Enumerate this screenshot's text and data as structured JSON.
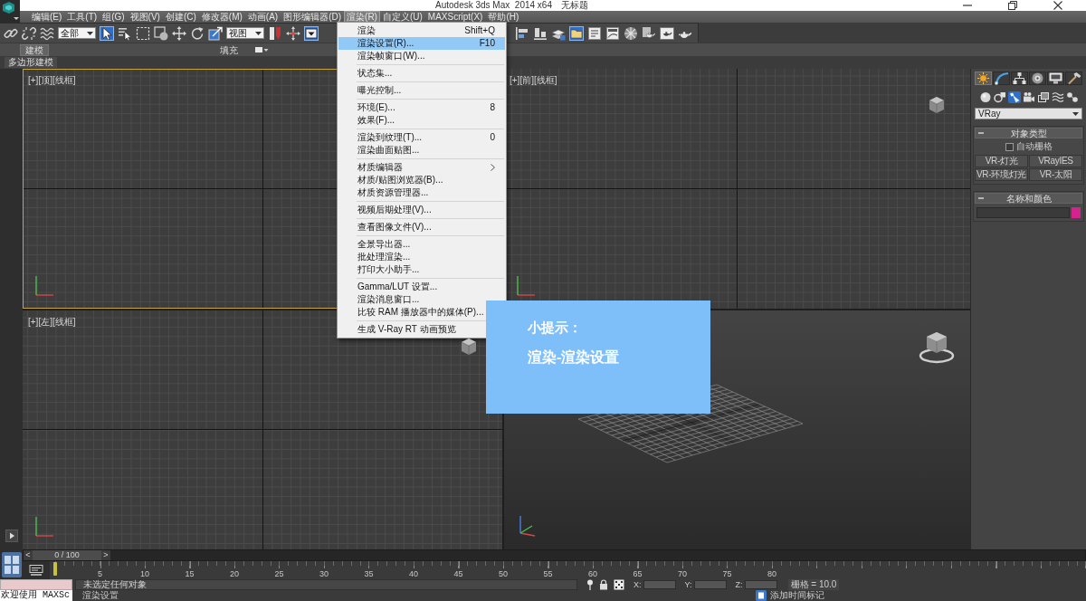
{
  "window": {
    "title": "Autodesk 3ds Max  2014 x64",
    "document": "无标题"
  },
  "menu_bar": [
    {
      "label": "编辑(E)",
      "selected": false
    },
    {
      "label": "工具(T)",
      "selected": false
    },
    {
      "label": "组(G)",
      "selected": false
    },
    {
      "label": "视图(V)",
      "selected": false
    },
    {
      "label": "创建(C)",
      "selected": false
    },
    {
      "label": "修改器(M)",
      "selected": false
    },
    {
      "label": "动画(A)",
      "selected": false
    },
    {
      "label": "图形编辑器(D)",
      "selected": false
    },
    {
      "label": "渲染(R)",
      "selected": true
    },
    {
      "label": "自定义(U)",
      "selected": false
    },
    {
      "label": "MAXScript(X)",
      "selected": false
    },
    {
      "label": "帮助(H)",
      "selected": false
    }
  ],
  "toolbar": {
    "left": [
      {
        "kind": "link",
        "selected": false
      },
      {
        "kind": "unlink",
        "selected": false
      },
      {
        "kind": "bind",
        "selected": false
      },
      {
        "kind": "dropdown",
        "value": "全部"
      },
      {
        "kind": "select",
        "selected": true
      },
      {
        "kind": "select_by_name",
        "selected": false
      },
      {
        "kind": "region",
        "selected": false
      },
      {
        "kind": "crossing",
        "selected": false
      },
      {
        "kind": "move",
        "selected": false
      },
      {
        "kind": "rotate",
        "selected": false
      },
      {
        "kind": "scale",
        "selected": false
      },
      {
        "kind": "dropdown",
        "value": "视图"
      },
      {
        "kind": "pivot",
        "selected": false
      },
      {
        "kind": "manipulate",
        "selected": false
      },
      {
        "kind": "shortcut",
        "selected": true
      }
    ],
    "right": [
      {
        "kind": "align",
        "selected": false
      },
      {
        "kind": "quick_align",
        "selected": false
      },
      {
        "kind": "layers",
        "selected": false
      },
      {
        "kind": "scene_explorer",
        "selected": true
      },
      {
        "kind": "ribbon",
        "selected": false
      },
      {
        "kind": "curve_editor",
        "selected": false
      },
      {
        "kind": "material_editor",
        "selected": false
      },
      {
        "kind": "render_setup",
        "selected": false
      },
      {
        "kind": "frame_window",
        "selected": false
      },
      {
        "kind": "render",
        "selected": false
      }
    ]
  },
  "ribbon": {
    "tabs": [
      {
        "label": "建模",
        "selected": true
      },
      {
        "label": "填充",
        "selected": false
      }
    ],
    "panel": "多边形建模"
  },
  "viewports": [
    {
      "kind": "ortho",
      "label": "[+][顶][线框]",
      "active": true,
      "view_cube": false
    },
    {
      "kind": "ortho",
      "label": "[+][前][线框]",
      "active": false,
      "view_cube": true
    },
    {
      "kind": "ortho",
      "label": "[+][左][线框]",
      "active": false,
      "view_cube": true
    },
    {
      "kind": "perspective",
      "active": false,
      "view_cube": true
    }
  ],
  "command_panel": {
    "tabs": [
      {
        "kind": "create",
        "selected": true
      },
      {
        "kind": "modify",
        "selected": false
      },
      {
        "kind": "hierarchy",
        "selected": false
      },
      {
        "kind": "motion",
        "selected": false
      },
      {
        "kind": "display",
        "selected": false
      },
      {
        "kind": "utilities",
        "selected": false
      }
    ],
    "categories": [
      {
        "kind": "geometry",
        "selected": false
      },
      {
        "kind": "shapes",
        "selected": false
      },
      {
        "kind": "lights",
        "selected": true
      },
      {
        "kind": "cameras",
        "selected": false
      },
      {
        "kind": "helpers",
        "selected": false
      },
      {
        "kind": "space_warps",
        "selected": false
      },
      {
        "kind": "systems",
        "selected": false
      }
    ],
    "dropdown": "VRay",
    "rollouts": [
      {
        "kind": "object_type",
        "title": "对象类型",
        "expanded": true,
        "autogrid": {
          "label": "自动栅格",
          "checked": false
        },
        "buttons": [
          "VR-灯光",
          "VRayIES",
          "VR-环境灯光",
          "VR-太阳"
        ]
      },
      {
        "kind": "name_color",
        "title": "名称和颜色",
        "expanded": true,
        "color": "#d4238c"
      }
    ]
  },
  "time_slider": {
    "prev": "<",
    "position": "0 / 100",
    "next": ">",
    "level": 0
  },
  "track_bar": {
    "labels": [
      "5",
      "10",
      "15",
      "20",
      "25",
      "30",
      "35",
      "40",
      "45",
      "50",
      "55",
      "60",
      "65",
      "70",
      "75",
      "80"
    ]
  },
  "status_bar": {
    "listener": "欢迎使用 MAXSc",
    "prompt": "未选定任何对象",
    "hint": "渲染设置",
    "coords": [
      "X:",
      "Y:",
      "Z:"
    ],
    "grid": "栅格 = 10.0",
    "time_tag": "添加时间标记"
  },
  "render_menu": {
    "groups": [
      {
        "items": [
          {
            "label": "渲染",
            "shortcut": "Shift+Q",
            "selected": false,
            "submenu": false
          },
          {
            "label": "渲染设置(R)...",
            "shortcut": "F10",
            "selected": true,
            "submenu": false
          },
          {
            "label": "渲染帧窗口(W)...",
            "selected": false,
            "submenu": false
          }
        ]
      },
      {
        "items": [
          {
            "label": "状态集...",
            "selected": false,
            "submenu": false
          }
        ]
      },
      {
        "items": [
          {
            "label": "曝光控制...",
            "selected": false,
            "submenu": false
          }
        ]
      },
      {
        "items": [
          {
            "label": "环境(E)...",
            "shortcut": "8",
            "selected": false,
            "submenu": false
          },
          {
            "label": "效果(F)...",
            "selected": false,
            "submenu": false
          }
        ]
      },
      {
        "items": [
          {
            "label": "渲染到纹理(T)...",
            "shortcut": "0",
            "selected": false,
            "submenu": false
          },
          {
            "label": "渲染曲面贴图...",
            "selected": false,
            "submenu": false
          }
        ]
      },
      {
        "items": [
          {
            "label": "材质编辑器",
            "selected": false,
            "submenu": true
          },
          {
            "label": "材质/贴图浏览器(B)...",
            "selected": false,
            "submenu": false
          },
          {
            "label": "材质资源管理器...",
            "selected": false,
            "submenu": false
          }
        ]
      },
      {
        "items": [
          {
            "label": "视频后期处理(V)...",
            "selected": false,
            "submenu": false
          }
        ]
      },
      {
        "items": [
          {
            "label": "查看图像文件(V)...",
            "selected": false,
            "submenu": false
          }
        ]
      },
      {
        "items": [
          {
            "label": "全景导出器...",
            "selected": false,
            "submenu": false
          },
          {
            "label": "批处理渲染...",
            "selected": false,
            "submenu": false
          },
          {
            "label": "打印大小助手...",
            "selected": false,
            "submenu": false
          }
        ]
      },
      {
        "items": [
          {
            "label": "Gamma/LUT 设置...",
            "selected": false,
            "submenu": false
          },
          {
            "label": "渲染消息窗口...",
            "selected": false,
            "submenu": false
          },
          {
            "label": "比较 RAM 播放器中的媒体(P)...",
            "selected": false,
            "submenu": false
          }
        ]
      },
      {
        "items": [
          {
            "label": "生成 V-Ray RT 动画预览",
            "selected": false,
            "submenu": false
          }
        ]
      }
    ]
  },
  "tip": {
    "title": "小提示：",
    "text": "渲染-渲染设置"
  }
}
